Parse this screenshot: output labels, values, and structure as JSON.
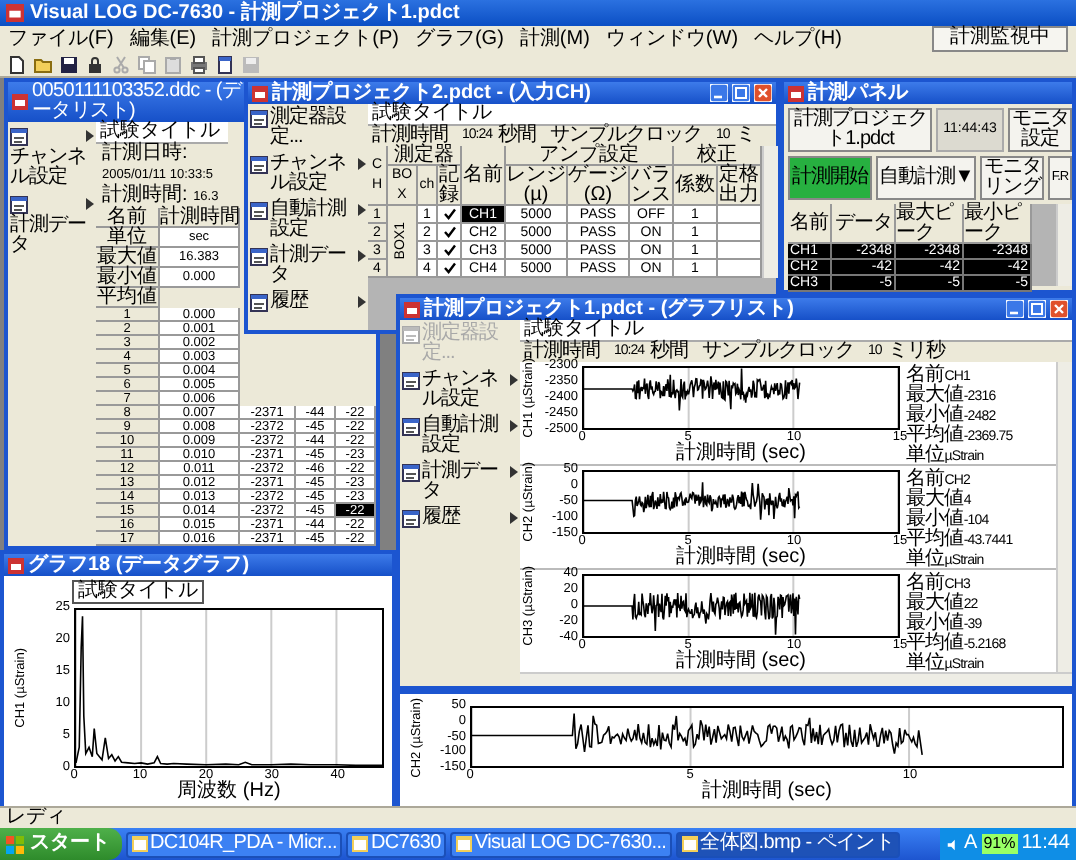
{
  "app": {
    "title": "Visual LOG DC-7630 - 計測プロジェクト1.pdct",
    "menu": [
      "ファイル(F)",
      "編集(E)",
      "計測プロジェクト(P)",
      "グラフ(G)",
      "計測(M)",
      "ウィンドウ(W)",
      "ヘルプ(H)"
    ],
    "monitor_status": "計測監視中"
  },
  "data_list": {
    "title": "0050111103352.ddc - (データリスト)",
    "sidebar": [
      {
        "label": "チャンネル設定",
        "disabled": false,
        "has_menu": true
      },
      {
        "label": "計測データ",
        "disabled": false,
        "has_menu": true
      }
    ],
    "test_title": "試験タイトル",
    "date_label": "計測日時:",
    "date_value": "2005/01/11 10:33:5",
    "duration_label": "計測時間:",
    "duration_value": "16.3",
    "columns": [
      "名前",
      "計測時間"
    ],
    "stat_rows": [
      [
        "単位",
        "sec"
      ],
      [
        "最大値",
        "16.383"
      ],
      [
        "最小値",
        "0.000"
      ],
      [
        "平均値"
      ]
    ],
    "rows": [
      {
        "cells": [
          "1",
          "0.000"
        ],
        "selected": false
      },
      {
        "cells": [
          "2",
          "0.001"
        ],
        "selected": false
      },
      {
        "cells": [
          "3",
          "0.002"
        ],
        "selected": false
      },
      {
        "cells": [
          "4",
          "0.003"
        ],
        "selected": false
      },
      {
        "cells": [
          "5",
          "0.004"
        ],
        "selected": false
      },
      {
        "cells": [
          "6",
          "0.005"
        ],
        "selected": false
      },
      {
        "cells": [
          "7",
          "0.006"
        ],
        "selected": false
      },
      {
        "cells": [
          "8",
          "0.007",
          "-2371",
          "-44",
          "-22"
        ],
        "selected": false
      },
      {
        "cells": [
          "9",
          "0.008",
          "-2372",
          "-45",
          "-22"
        ],
        "selected": false
      },
      {
        "cells": [
          "10",
          "0.009",
          "-2372",
          "-44",
          "-22"
        ],
        "selected": false
      },
      {
        "cells": [
          "11",
          "0.010",
          "-2371",
          "-45",
          "-23"
        ],
        "selected": false
      },
      {
        "cells": [
          "12",
          "0.011",
          "-2372",
          "-46",
          "-22"
        ],
        "selected": false
      },
      {
        "cells": [
          "13",
          "0.012",
          "-2371",
          "-45",
          "-23"
        ],
        "selected": false
      },
      {
        "cells": [
          "14",
          "0.013",
          "-2372",
          "-45",
          "-23"
        ],
        "selected": false
      },
      {
        "cells": [
          "15",
          "0.014",
          "-2372",
          "-45",
          "-22"
        ],
        "selected": true
      },
      {
        "cells": [
          "16",
          "0.015",
          "-2371",
          "-44",
          "-22"
        ],
        "selected": false
      },
      {
        "cells": [
          "17",
          "0.016",
          "-2371",
          "-45",
          "-22"
        ],
        "selected": false
      }
    ]
  },
  "input_ch": {
    "title": "計測プロジェクト2.pdct - (入力CH)",
    "sidebar": [
      {
        "label": "測定器設定...",
        "disabled": false,
        "has_menu": false
      },
      {
        "label": "チャンネル設定",
        "disabled": false,
        "has_menu": true
      },
      {
        "label": "自動計測設定",
        "disabled": false,
        "has_menu": true
      },
      {
        "label": "計測データ",
        "disabled": false,
        "has_menu": true
      },
      {
        "label": "履歴",
        "disabled": false,
        "has_menu": true
      }
    ],
    "test_title": "試験タイトル",
    "info": {
      "label": "計測時間",
      "value": "10:24",
      "unit": "秒間",
      "clock_label": "サンプルクロック",
      "clock_value": "10",
      "clock_unit": "ミ"
    },
    "ch_header": "CH",
    "name_header": "名前",
    "header_groups": [
      {
        "label": "測定器",
        "columns": [
          "BOX",
          "ch",
          "記録"
        ]
      },
      {
        "label": "アンプ設定",
        "columns": [
          "レンジ(µ)",
          "ゲージ(Ω)",
          "バランス"
        ]
      },
      {
        "label": "校正",
        "columns": [
          "係数",
          "定格出力"
        ]
      }
    ],
    "box": "BOX1",
    "rows": [
      {
        "ch": "1",
        "ch_no": "1",
        "recorded": true,
        "name": "CH1",
        "range": "5000",
        "gauge": "PASS",
        "balance": "OFF",
        "coef": "1",
        "selected": true
      },
      {
        "ch": "2",
        "ch_no": "2",
        "recorded": true,
        "name": "CH2",
        "range": "5000",
        "gauge": "PASS",
        "balance": "ON",
        "coef": "1",
        "selected": false
      },
      {
        "ch": "3",
        "ch_no": "3",
        "recorded": true,
        "name": "CH3",
        "range": "5000",
        "gauge": "PASS",
        "balance": "ON",
        "coef": "1",
        "selected": false
      },
      {
        "ch": "4",
        "ch_no": "4",
        "recorded": true,
        "name": "CH4",
        "range": "5000",
        "gauge": "PASS",
        "balance": "ON",
        "coef": "1",
        "selected": false
      }
    ]
  },
  "panel": {
    "title": "計測パネル",
    "project_button": "計測プロジェクト1.pdct",
    "clock": "11:44:43",
    "monitor_settings_button": "モニタ設定",
    "start_button": {
      "label": "計測開始",
      "active": true
    },
    "auto_button": "自動計測▼",
    "monitoring_button": "モニタリング",
    "fr_button": "F.R",
    "columns": [
      "名前",
      "データ",
      "最大ピーク",
      "最小ピーク"
    ],
    "rows": [
      [
        "CH1",
        "-2348",
        "-2348",
        "-2348"
      ],
      [
        "CH2",
        "-42",
        "-42",
        "-42"
      ],
      [
        "CH3",
        "-5",
        "-5",
        "-5"
      ]
    ]
  },
  "graph_list": {
    "title": "計測プロジェクト1.pdct - (グラフリスト)",
    "sidebar": [
      {
        "label": "測定器設定...",
        "disabled": true,
        "has_menu": false
      },
      {
        "label": "チャンネル設定",
        "disabled": false,
        "has_menu": true
      },
      {
        "label": "自動計測設定",
        "disabled": false,
        "has_menu": true
      },
      {
        "label": "計測データ",
        "disabled": false,
        "has_menu": true
      },
      {
        "label": "履歴",
        "disabled": false,
        "has_menu": true
      }
    ],
    "test_title": "試験タイトル",
    "info": {
      "label": "計測時間",
      "value": "10:24",
      "unit": "秒間",
      "clock_label": "サンプルクロック",
      "clock_value": "10",
      "clock_unit": "ミリ秒"
    },
    "graphs": [
      {
        "ylabel": "CH1 (µStrain)",
        "yticks": [
          "-2300",
          "-2350",
          "-2400",
          "-2450",
          "-2500"
        ],
        "xticks": [
          "0",
          "5",
          "10",
          "15"
        ],
        "xlabel": "計測時間 (sec)",
        "stats": [
          {
            "label": "名前",
            "value": "CH1"
          },
          {
            "label": "最大値",
            "value": "-2316"
          },
          {
            "label": "最小値",
            "value": "-2482"
          },
          {
            "label": "平均値",
            "value": "-2369.75"
          },
          {
            "label": "単位",
            "value": "µStrain"
          }
        ]
      },
      {
        "ylabel": "CH2 (µStrain)",
        "yticks": [
          "50",
          "0",
          "-50",
          "-100",
          "-150"
        ],
        "xticks": [
          "0",
          "5",
          "10",
          "15"
        ],
        "xlabel": "計測時間 (sec)",
        "stats": [
          {
            "label": "名前",
            "value": "CH2"
          },
          {
            "label": "最大値",
            "value": "4"
          },
          {
            "label": "最小値",
            "value": "-104"
          },
          {
            "label": "平均値",
            "value": "-43.7441"
          },
          {
            "label": "単位",
            "value": "µStrain"
          }
        ]
      },
      {
        "ylabel": "CH3 (µStrain)",
        "yticks": [
          "40",
          "20",
          "0",
          "-20",
          "-40"
        ],
        "xticks": [
          "0",
          "5",
          "10",
          "15"
        ],
        "xlabel": "計測時間 (sec)",
        "stats": [
          {
            "label": "名前",
            "value": "CH3"
          },
          {
            "label": "最大値",
            "value": "22"
          },
          {
            "label": "最小値",
            "value": "-39"
          },
          {
            "label": "平均値",
            "value": "-5.2168"
          },
          {
            "label": "単位",
            "value": "µStrain"
          }
        ]
      }
    ]
  },
  "fft_graph": {
    "title": "グラフ18 (データグラフ)",
    "test_title_button": "試験タイトル",
    "chart_data": {
      "type": "line",
      "xlabel": "周波数 (Hz)",
      "ylabel": "CH1 (µStrain)",
      "x": [
        0,
        0.5,
        0.8,
        1.0,
        1.2,
        1.5,
        2,
        2.5,
        2.8,
        3.2,
        3.6,
        4,
        4.5,
        5,
        5.5,
        6,
        6.5,
        7,
        8,
        9,
        10,
        11,
        12,
        12.5,
        13,
        14,
        15,
        17,
        20,
        23,
        25,
        26,
        27,
        30,
        33,
        36,
        40,
        43,
        47
      ],
      "series": [
        {
          "color": "#000000",
          "values": [
            0.5,
            3,
            19,
            24,
            8,
            2,
            3,
            1.5,
            6,
            2,
            1.5,
            1,
            4.5,
            1.2,
            1.8,
            0.8,
            1.5,
            0.6,
            0.5,
            0.4,
            0.5,
            0.3,
            0.5,
            1.5,
            0.4,
            0.3,
            0.4,
            0.3,
            0.2,
            0.3,
            0.2,
            0.6,
            0.2,
            0.2,
            0.3,
            0.2,
            0.2,
            0.1,
            0.1
          ]
        }
      ],
      "xlim": [
        0,
        47
      ],
      "ylim": [
        0,
        25
      ],
      "xticks": [
        0,
        10,
        20,
        30,
        40
      ],
      "yticks": [
        0,
        5,
        10,
        15,
        20,
        25
      ],
      "grid": true
    }
  },
  "wave_graph": {
    "ylabel": "CH2 (µStrain)",
    "yticks": [
      "50",
      "0",
      "-50",
      "-100",
      "-150"
    ],
    "xticks": [
      "0",
      "5",
      "10"
    ],
    "xlabel": "計測時間 (sec)"
  },
  "status_bar": "レディ",
  "taskbar": {
    "start": "スタート",
    "tasks": [
      {
        "label": "DC104R_PDA - Micr...",
        "selected": false
      },
      {
        "label": "DC7630",
        "selected": false
      },
      {
        "label": "Visual LOG DC-7630...",
        "selected": false
      },
      {
        "label": "全体図.bmp - ペイント",
        "selected": true
      }
    ],
    "ime": "A",
    "battery": "91%",
    "clock": "11:44"
  }
}
